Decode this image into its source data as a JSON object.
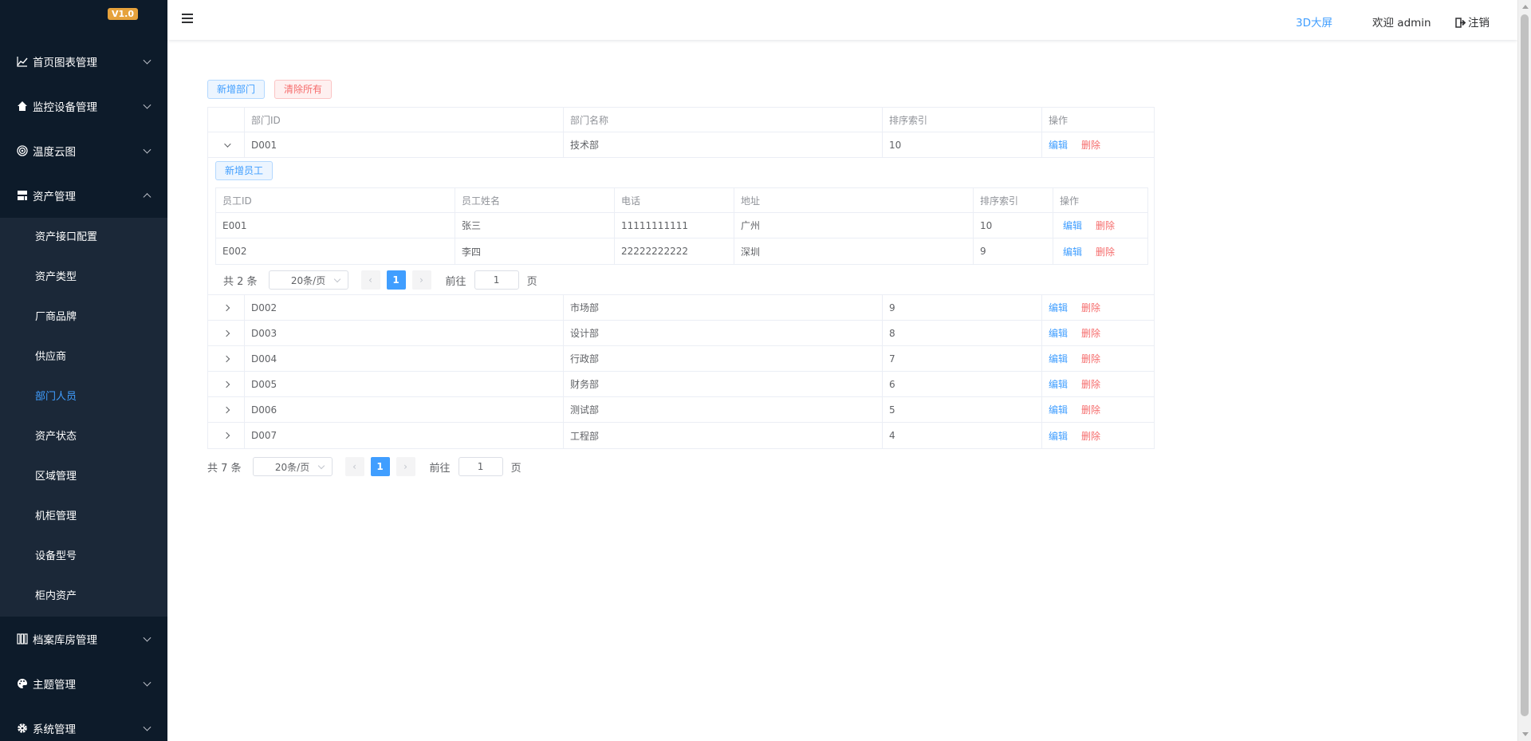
{
  "app": {
    "version": "V1.0"
  },
  "sidebar": {
    "groups": [
      {
        "label": "首页图表管理",
        "icon": "chart-line-icon"
      },
      {
        "label": "监控设备管理",
        "icon": "home-icon"
      },
      {
        "label": "温度云图",
        "icon": "target-icon"
      },
      {
        "label": "资产管理",
        "icon": "server-icon",
        "expanded": true
      }
    ],
    "asset_items": [
      {
        "label": "资产接口配置"
      },
      {
        "label": "资产类型"
      },
      {
        "label": "厂商品牌"
      },
      {
        "label": "供应商"
      },
      {
        "label": "部门人员",
        "active": true
      },
      {
        "label": "资产状态"
      },
      {
        "label": "区域管理"
      },
      {
        "label": "机柜管理"
      },
      {
        "label": "设备型号"
      },
      {
        "label": "柜内资产"
      }
    ],
    "bottom_groups": [
      {
        "label": "档案库房管理",
        "icon": "grid-icon"
      },
      {
        "label": "主题管理",
        "icon": "palette-icon"
      },
      {
        "label": "系统管理",
        "icon": "gear-icon"
      }
    ]
  },
  "header": {
    "screen_link": "3D大屏",
    "welcome": "欢迎 admin",
    "logout": "注销"
  },
  "toolbar": {
    "add_dept": "新增部门",
    "clear_all": "清除所有"
  },
  "dept_table": {
    "columns": [
      "部门ID",
      "部门名称",
      "排序索引",
      "操作"
    ],
    "edit_label": "编辑",
    "delete_label": "删除",
    "rows": [
      {
        "id": "D001",
        "name": "技术部",
        "sort": "10",
        "expanded": true
      },
      {
        "id": "D002",
        "name": "市场部",
        "sort": "9"
      },
      {
        "id": "D003",
        "name": "设计部",
        "sort": "8"
      },
      {
        "id": "D004",
        "name": "行政部",
        "sort": "7"
      },
      {
        "id": "D005",
        "name": "财务部",
        "sort": "6"
      },
      {
        "id": "D006",
        "name": "测试部",
        "sort": "5"
      },
      {
        "id": "D007",
        "name": "工程部",
        "sort": "4"
      }
    ]
  },
  "employee_panel": {
    "add_employee": "新增员工",
    "columns": [
      "员工ID",
      "员工姓名",
      "电话",
      "地址",
      "排序索引",
      "操作"
    ],
    "rows": [
      {
        "id": "E001",
        "name": "张三",
        "phone": "11111111111",
        "address": "广州",
        "sort": "10"
      },
      {
        "id": "E002",
        "name": "李四",
        "phone": "22222222222",
        "address": "深圳",
        "sort": "9"
      }
    ],
    "pager": {
      "total": "共 2 条",
      "size": "20条/页",
      "page": "1",
      "goto": "前往",
      "jump": "1",
      "unit": "页"
    }
  },
  "dept_pager": {
    "total": "共 7 条",
    "size": "20条/页",
    "page": "1",
    "goto": "前往",
    "jump": "1",
    "unit": "页"
  }
}
